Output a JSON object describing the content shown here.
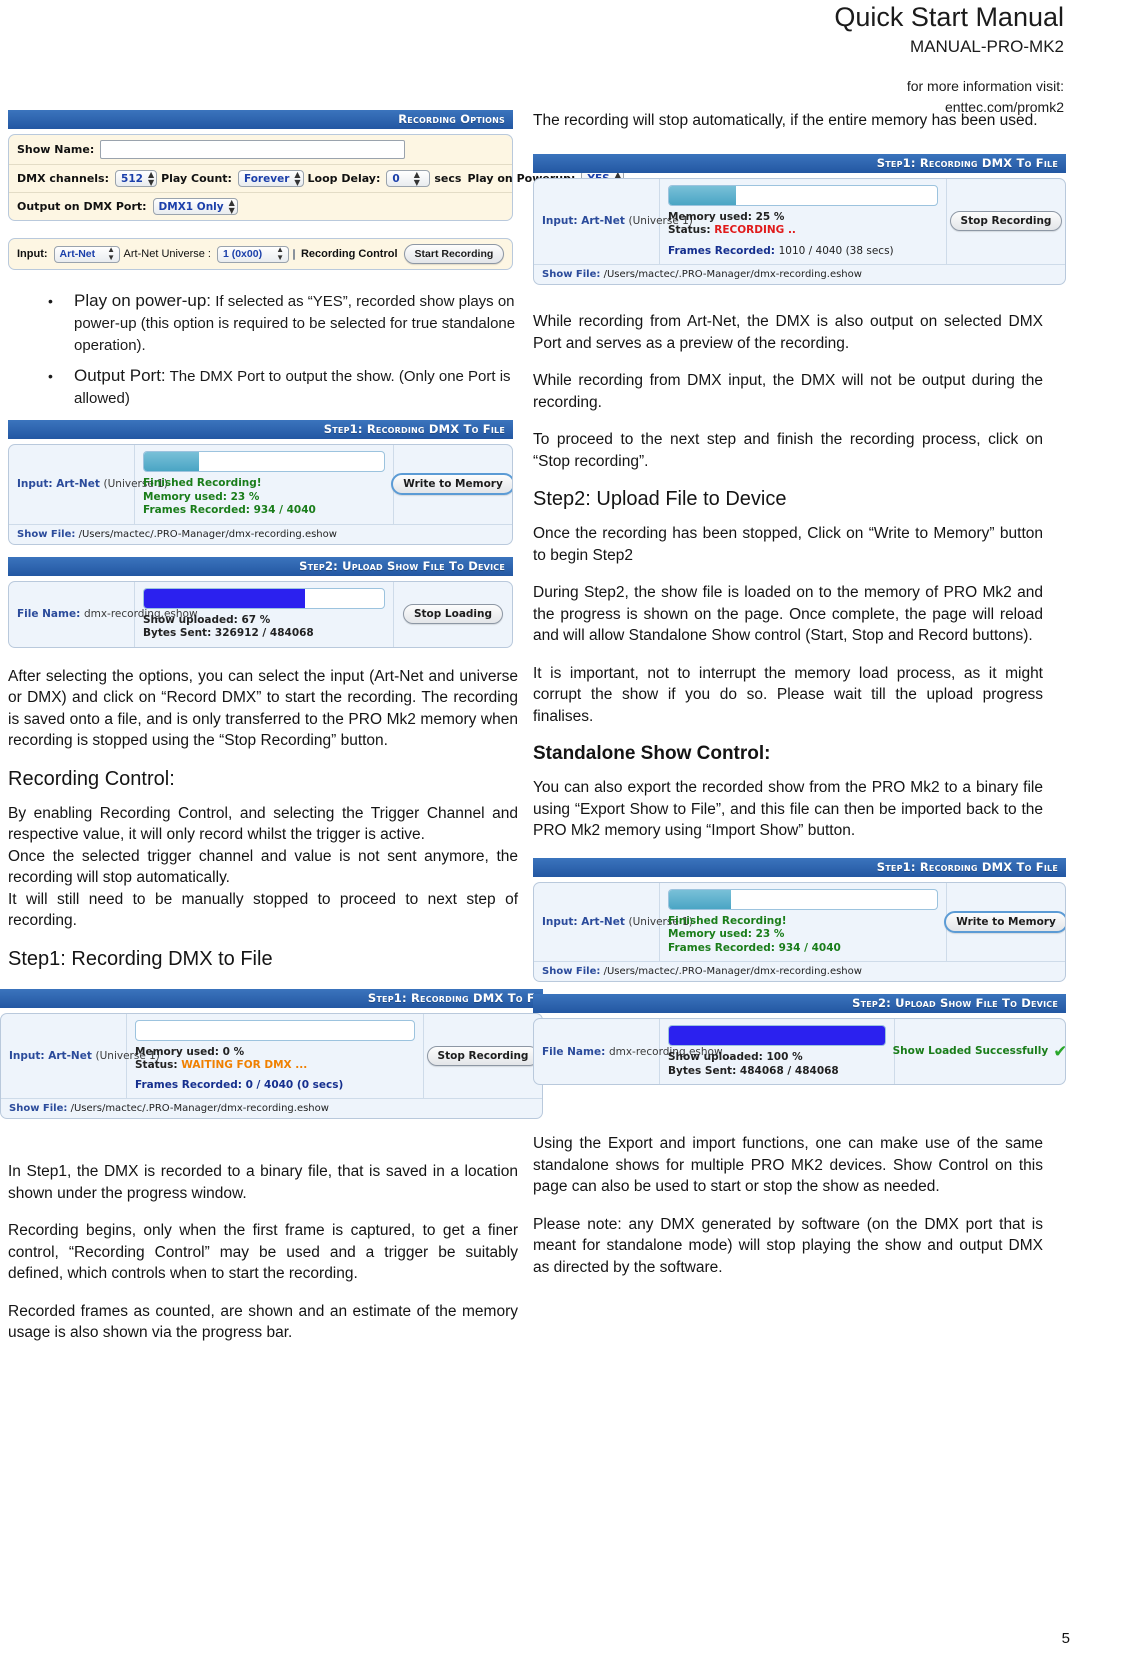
{
  "header": {
    "title": "Quick Start Manual",
    "doc_code": "MANUAL-PRO-MK2",
    "info_line": "for more information visit:",
    "url": "enttec.com/promk2"
  },
  "page_number": "5",
  "colors": {
    "panel_header": "#2b62ab",
    "progress_blue": "#2b21ef",
    "progress_teal": "#4aa5c4",
    "status_green": "#1a7d1a",
    "status_red": "#e01b1b",
    "status_orange": "#f08000",
    "link_navy": "#2b4b9b"
  },
  "recording_options_panel": {
    "header": "Recording Options",
    "show_name_label": "Show Name:",
    "show_name_value": "",
    "dmx_channels_label": "DMX channels:",
    "dmx_channels_value": "512",
    "play_count_label": "Play Count:",
    "play_count_value": "Forever",
    "loop_delay_label": "Loop Delay:",
    "loop_delay_value": "0",
    "loop_delay_units": "secs",
    "play_on_powerup_label": "Play on Powerup:",
    "play_on_powerup_value": "YES",
    "output_port_label": "Output on DMX Port:",
    "output_port_value": "DMX1 Only"
  },
  "input_panel": {
    "input_label": "Input:",
    "input_value": "Art-Net",
    "universe_label": "Art-Net Universe :",
    "universe_value": "1 (0x00)",
    "recording_control_label": "Recording Control",
    "start_recording_button": "Start Recording"
  },
  "bullets": [
    {
      "lead": "Play on power-up:",
      "rest": " If selected as “YES”, recorded show plays on power-up (this option is required to be selected for true standalone operation)."
    },
    {
      "lead": "Output Port:",
      "rest": " The DMX Port to output the show. (Only one Port is allowed)"
    }
  ],
  "panel_finished_left": {
    "header": "Step1: Recording DMX To File",
    "input_bold": "Input: Art-Net",
    "input_rest": "(Universe 1)",
    "progress_percent": 23,
    "line1": "Finished Recording!",
    "line2": "Memory used: 23 %",
    "line3": "Frames Recorded: 934 / 4040",
    "button": "Write to Memory",
    "show_file_label": "Show File:",
    "show_file_path": "/Users/mactec/.PRO-Manager/dmx-recording.eshow"
  },
  "panel_upload_left": {
    "header": "Step2: Upload Show File To Device",
    "file_name_label": "File Name:",
    "file_name_value": "dmx-recording.eshow",
    "progress_percent": 67,
    "line1": "Show uploaded: 67 %",
    "line2": "Bytes Sent: 326912 / 484068",
    "button": "Stop Loading"
  },
  "panel_waiting_left": {
    "header": "Step1: Recording DMX To F",
    "input_bold": "Input: Art-Net",
    "input_rest": "(Universe 1)",
    "progress_percent": 0,
    "line1": "Memory used: 0 %",
    "line2_label": "Status:",
    "line2_value": "WAITING FOR DMX ...",
    "line3": "Frames Recorded: 0 / 4040 (0 secs)",
    "button": "Stop Recording",
    "show_file_label": "Show File:",
    "show_file_path": "/Users/mactec/.PRO-Manager/dmx-recording.eshow"
  },
  "panel_recording_right": {
    "header": "Step1: Recording DMX To File",
    "input_bold": "Input: Art-Net",
    "input_rest": "(Universe 1)",
    "progress_percent": 25,
    "line1": "Memory used: 25 %",
    "line2_label": "Status:",
    "line2_value": "RECORDING ..",
    "line3_label": "Frames Recorded:",
    "line3_value": "1010 / 4040 (38 secs)",
    "button": "Stop Recording",
    "show_file_label": "Show File:",
    "show_file_path": "/Users/mactec/.PRO-Manager/dmx-recording.eshow"
  },
  "panel_finished_right": {
    "header": "Step1: Recording DMX To File",
    "input_bold": "Input: Art-Net",
    "input_rest": "(Universe 1)",
    "progress_percent": 23,
    "line1": "Finished Recording!",
    "line2": "Memory used: 23 %",
    "line3": "Frames Recorded: 934 / 4040",
    "button": "Write to Memory",
    "show_file_label": "Show File:",
    "show_file_path": "/Users/mactec/.PRO-Manager/dmx-recording.eshow"
  },
  "panel_upload_right": {
    "header": "Step2: Upload Show File To Device",
    "file_name_label": "File Name:",
    "file_name_value": "dmx-recording.eshow",
    "progress_percent": 100,
    "line1": "Show uploaded: 100 %",
    "line2": "Bytes Sent: 484068 / 484068",
    "status": "Show Loaded Successfully",
    "tick": "✔"
  },
  "left_text": {
    "p_after_options": "After selecting the options, you can select the input (Art-Net and universe or DMX) and click on “Record DMX” to start the recording. The recording is saved onto a file, and is only transferred to the PRO Mk2 memory when recording is stopped using the “Stop Recording” button.",
    "h_recording_control": "Recording Control:",
    "p_rc_1": "By enabling Recording Control, and selecting the Trigger Channel and respective value, it will only record whilst the trigger is active.",
    "p_rc_2": "Once the selected trigger channel and value is not sent anymore, the recording will stop automatically.",
    "p_rc_3": "It will still need to be manually stopped to proceed to next step of recording.",
    "h_step1": "Step1: Recording DMX to File",
    "p_s1_1": "In Step1, the DMX is recorded to a binary file, that is saved in a location shown under the progress window.",
    "p_s1_2": "Recording begins, only when the first frame is captured, to get a finer control, “Recording Control” may be used and  a trigger be suitably defined, which controls when to start the recording.",
    "p_s1_3": "Recorded frames as counted, are shown and an estimate of the memory usage is also shown via the progress bar."
  },
  "right_text": {
    "p_top": "The recording will stop automatically, if the entire memory has been used.",
    "p_1": "While recording from Art-Net, the DMX is also output on selected DMX Port and serves as a preview of the recording.",
    "p_2": "While recording from DMX input, the DMX will not be output during the recording.",
    "p_3": "To proceed to the next step and finish the recording process, click on “Stop recording”.",
    "h_step2": "Step2: Upload File to Device",
    "p_4": "Once the recording has been stopped, Click on “Write to Memory” button to begin Step2",
    "p_5": "During Step2, the show file is loaded on to the memory of PRO Mk2 and the progress is shown on the page. Once complete, the page will reload and will allow Standalone Show control (Start, Stop and Record buttons).",
    "p_6": "It is important, not to interrupt the memory load process, as it might corrupt the show if you do so. Please wait till the upload progress finalises.",
    "h_standalone": "Standalone Show Control:",
    "p_7": "You can also export the recorded show from the PRO Mk2 to a binary file using “Export Show to File”, and this file can then be imported back to the PRO Mk2 memory using “Import Show” button.",
    "p_8": "Using the Export and import functions, one can make use of the same standalone shows for multiple PRO MK2 devices. Show Control on this page can also be used to start or stop the show as needed.",
    "p_9": "Please note: any DMX generated by software (on the DMX port that is meant for standalone mode) will stop playing the show and output DMX as directed by the software."
  }
}
